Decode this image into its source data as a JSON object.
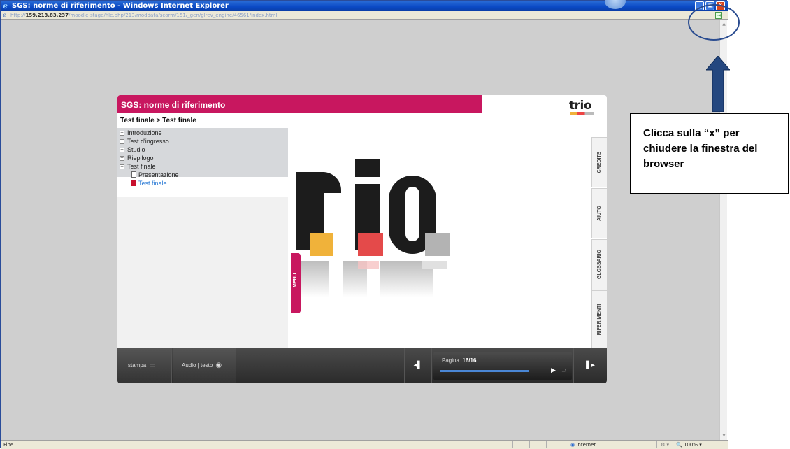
{
  "window": {
    "title": "SGS: norme di riferimento - Windows Internet Explorer",
    "url_prefix": "http://",
    "url_host": "159.213.83.237",
    "url_path": "/moodle-stage/file.php/213/moddata/scorm/151/_gen/glrev_engine/46561/index.html",
    "min_glyph": "▁",
    "max_glyph": "▣",
    "close_glyph": "✕"
  },
  "statusbar": {
    "text": "Fine",
    "zone": "Internet",
    "zoom": "100%"
  },
  "course": {
    "title": "SGS: norme di riferimento",
    "logo": "trio",
    "breadcrumb": "Test finale > Test finale",
    "menu": [
      {
        "label": "Introduzione",
        "toggle": "+"
      },
      {
        "label": "Test d'ingresso",
        "toggle": "+"
      },
      {
        "label": "Studio",
        "toggle": "+"
      },
      {
        "label": "Riepilogo",
        "toggle": "+"
      },
      {
        "label": "Test finale",
        "toggle": "−"
      }
    ],
    "submenu": [
      {
        "label": "Presentazione",
        "active": false
      },
      {
        "label": "Test finale",
        "active": true
      }
    ],
    "menu_tab": "MENU",
    "side_tabs": [
      "CREDITS",
      "AIUTO",
      "GLOSSARIO",
      "RIFERIMENTI"
    ]
  },
  "controls": {
    "stampa": "stampa",
    "audio": "Audio | testo",
    "page_prefix": "Pagina",
    "page_value": "16/16",
    "progress_fraction": 0.7
  },
  "annotation": {
    "text": "Clicca sulla “x” per chiudere la finestra del  browser"
  },
  "colors": {
    "brand": "#c8175f",
    "accent_blue": "#4a87d6"
  }
}
